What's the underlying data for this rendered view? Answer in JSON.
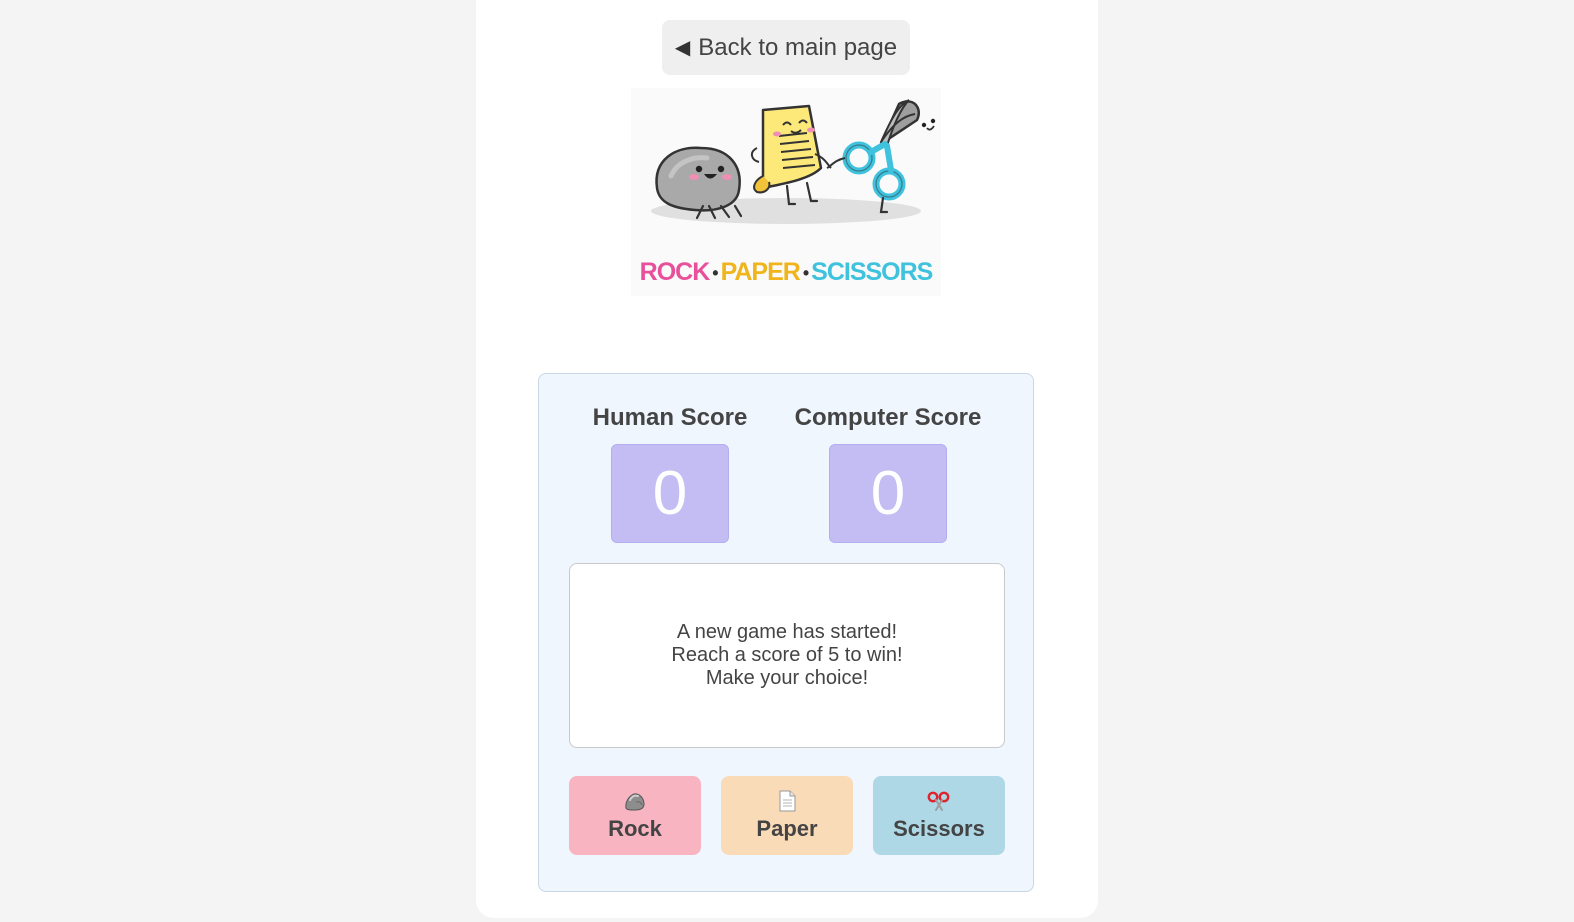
{
  "nav": {
    "back_arrow": "◀",
    "back_label": "Back to main page"
  },
  "logo": {
    "rock": "ROCK",
    "paper": "PAPER",
    "scissors": "SCISSORS",
    "separator": "•"
  },
  "scores": {
    "human_title": "Human Score",
    "human_value": "0",
    "computer_title": "Computer Score",
    "computer_value": "0"
  },
  "message": {
    "line1": "A new game has started!",
    "line2": "Reach a score of 5 to win!",
    "line3": "Make your choice!"
  },
  "choices": {
    "rock_label": "Rock",
    "rock_icon": "rock-icon",
    "paper_label": "Paper",
    "paper_icon": "page-icon",
    "scissors_label": "Scissors",
    "scissors_icon": "scissors-icon"
  },
  "colors": {
    "score_box": "#c3bdf4",
    "rock_button": "#f8b5c1",
    "paper_button": "#fadbb8",
    "scissors_button": "#aed8e6",
    "panel_bg": "#eff6fd"
  }
}
